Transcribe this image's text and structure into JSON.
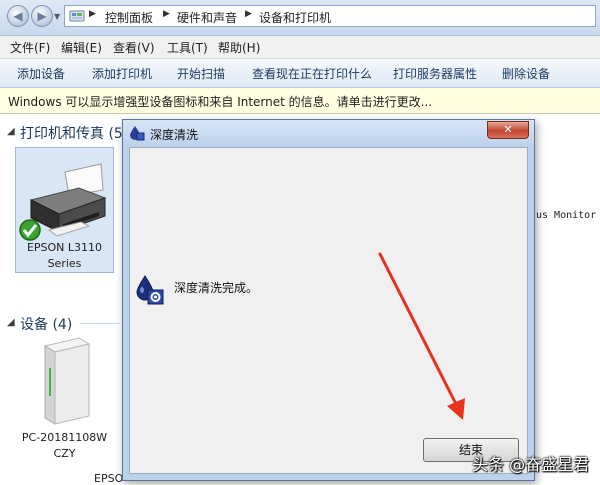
{
  "address_bar": {
    "breadcrumbs": [
      "控制面板",
      "硬件和声音",
      "设备和打印机"
    ]
  },
  "menu_bar": {
    "items": [
      "文件(F)",
      "编辑(E)",
      "查看(V)",
      "工具(T)",
      "帮助(H)"
    ]
  },
  "toolbar": {
    "items": [
      "添加设备",
      "添加打印机",
      "开始扫描",
      "查看现在正在打印什么",
      "打印服务器属性",
      "删除设备"
    ]
  },
  "info_bar": {
    "text": "Windows 可以显示增强型设备图标和来自 Internet 的信息。请单击进行更改..."
  },
  "printers_section": {
    "header": "打印机和传真 (5",
    "devices": [
      {
        "name_line1": "EPSON L3110",
        "name_line2": "Series",
        "icon": "printer-icon",
        "default": true
      }
    ],
    "behind_dialog_text": "us Monitor"
  },
  "devices_section": {
    "header": "设备 (4)",
    "devices": [
      {
        "name_line1": "PC-20181108W",
        "name_line2": "CZY",
        "icon": "computer-tower-icon"
      }
    ],
    "partial_next_label": "EPSO"
  },
  "dialog": {
    "title": "深度清洗",
    "message": "深度清洗完成。",
    "end_button": "结束",
    "close_glyph": "✕"
  },
  "watermark": {
    "text": "头条 @奋盛星君"
  },
  "colors": {
    "accent_blue": "#1e395b",
    "info_bar_bg": "#ffffe1",
    "dialog_frame": "#bcd2ec",
    "annotation_arrow": "#e8321e"
  }
}
